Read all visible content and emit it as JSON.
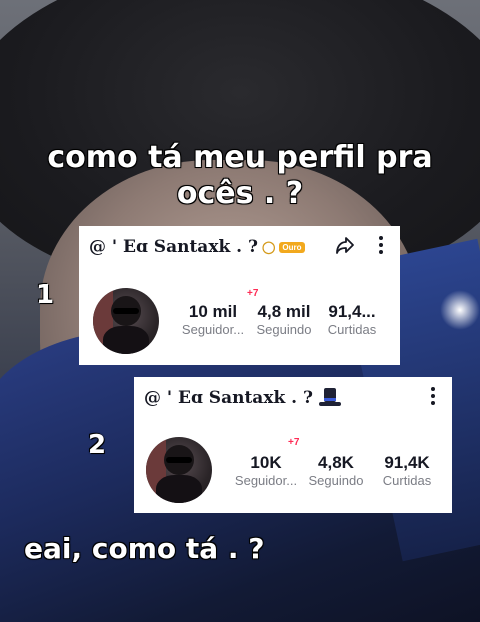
{
  "caption_top": "como tá meu perfil pra ocês . ?",
  "caption_bottom": "eai, como tá . ?",
  "markers": {
    "one": "1",
    "two": "2"
  },
  "profile1": {
    "handle": "@ ' Eɑ Santaxk . ?",
    "badge": "Ouro",
    "new_followers": "+7",
    "stats": [
      {
        "value": "10 mil",
        "label": "Seguidor..."
      },
      {
        "value": "4,8 mil",
        "label": "Seguindo"
      },
      {
        "value": "91,4...",
        "label": "Curtidas"
      }
    ]
  },
  "profile2": {
    "handle": "@ ' Eɑ Santaxk . ?",
    "new_followers": "+7",
    "stats": [
      {
        "value": "10K",
        "label": "Seguidor..."
      },
      {
        "value": "4,8K",
        "label": "Seguindo"
      },
      {
        "value": "91,4K",
        "label": "Curtidas"
      }
    ]
  },
  "icons": {
    "share": "share-icon",
    "more": "more-vertical-icon",
    "hat": "top-hat-emoji"
  },
  "colors": {
    "new_badge": "#fe2c55",
    "card_bg": "#ffffff",
    "muted": "#7b7d85"
  }
}
